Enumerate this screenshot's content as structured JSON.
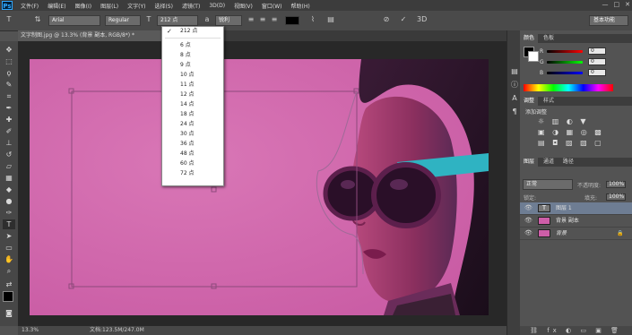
{
  "menu": {
    "logo": "Ps",
    "items": [
      "文件(F)",
      "编辑(E)",
      "图像(I)",
      "图层(L)",
      "文字(Y)",
      "选择(S)",
      "滤镜(T)",
      "3D(D)",
      "视图(V)",
      "窗口(W)",
      "帮助(H)"
    ],
    "win_controls": [
      "—",
      "□",
      "✕"
    ]
  },
  "options": {
    "font_family": "Arial",
    "font_style": "Regular",
    "font_size": "212 点",
    "antialias": "锐利",
    "workspace": "基本功能"
  },
  "document": {
    "tab_title": "文字制图.jpg @ 13.3% (背景 副本, RGB/8*) *",
    "zoom": "13.3%",
    "doc_size": "文档:123.5M/247.0M"
  },
  "font_size_menu": {
    "selected": "212 点",
    "items": [
      "6 点",
      "8 点",
      "9 点",
      "10 点",
      "11 点",
      "12 点",
      "14 点",
      "18 点",
      "24 点",
      "30 点",
      "36 点",
      "48 点",
      "60 点",
      "72 点"
    ]
  },
  "color_panel": {
    "tabs": [
      "颜色",
      "色板"
    ],
    "r": "0",
    "g": "0",
    "b": "0"
  },
  "adjust_panel": {
    "tabs": [
      "调整",
      "样式"
    ],
    "heading": "添加调整"
  },
  "layers_panel": {
    "tabs": [
      "图层",
      "通道",
      "路径"
    ],
    "blend_mode": "正常",
    "opacity_label": "不透明度:",
    "opacity": "100%",
    "lock_label": "锁定:",
    "fill_label": "填充:",
    "fill": "100%",
    "layers": [
      {
        "name": "图层 1",
        "type": "text"
      },
      {
        "name": "背景 副本",
        "type": "image"
      },
      {
        "name": "背景",
        "type": "image"
      }
    ]
  },
  "colors": {
    "canvas_pink": "#cd5ea8",
    "sunglass_teal": "#2fb3c2"
  }
}
